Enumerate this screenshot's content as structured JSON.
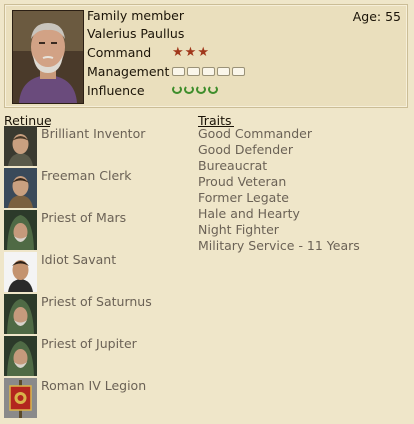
{
  "character": {
    "role": "Family member",
    "name": "Valerius Paullus",
    "age_label": "Age: 55",
    "command": {
      "label": "Command",
      "value": 3,
      "icon": "star-icon",
      "color": "#a0371b"
    },
    "management": {
      "label": "Management",
      "value": 5,
      "icon": "scroll-icon",
      "color": "#faf6ea"
    },
    "influence": {
      "label": "Influence",
      "value": 4,
      "icon": "laurel-wreath-icon",
      "color": "#3f8e2c"
    }
  },
  "retinue": {
    "title": "Retinue",
    "items": [
      {
        "name": "Brilliant Inventor",
        "icon": "inventor-portrait"
      },
      {
        "name": "Freeman Clerk",
        "icon": "clerk-portrait"
      },
      {
        "name": "Priest of Mars",
        "icon": "hooded-priest-portrait"
      },
      {
        "name": "Idiot Savant",
        "icon": "savant-portrait"
      },
      {
        "name": "Priest of Saturnus",
        "icon": "hooded-priest-portrait"
      },
      {
        "name": "Priest of Jupiter",
        "icon": "hooded-priest-portrait"
      },
      {
        "name": "Roman IV Legion",
        "icon": "legion-standard-icon"
      }
    ]
  },
  "traits": {
    "title": "Traits",
    "items": [
      "Good Commander",
      "Good Defender",
      "Bureaucrat",
      "Proud Veteran",
      "Former Legate",
      "Hale and Hearty",
      "Night Fighter",
      "Military Service - 11 Years"
    ]
  },
  "colors": {
    "background": "#efe6c9",
    "panel": "#eadfbd",
    "muted_text": "#6b6256"
  }
}
